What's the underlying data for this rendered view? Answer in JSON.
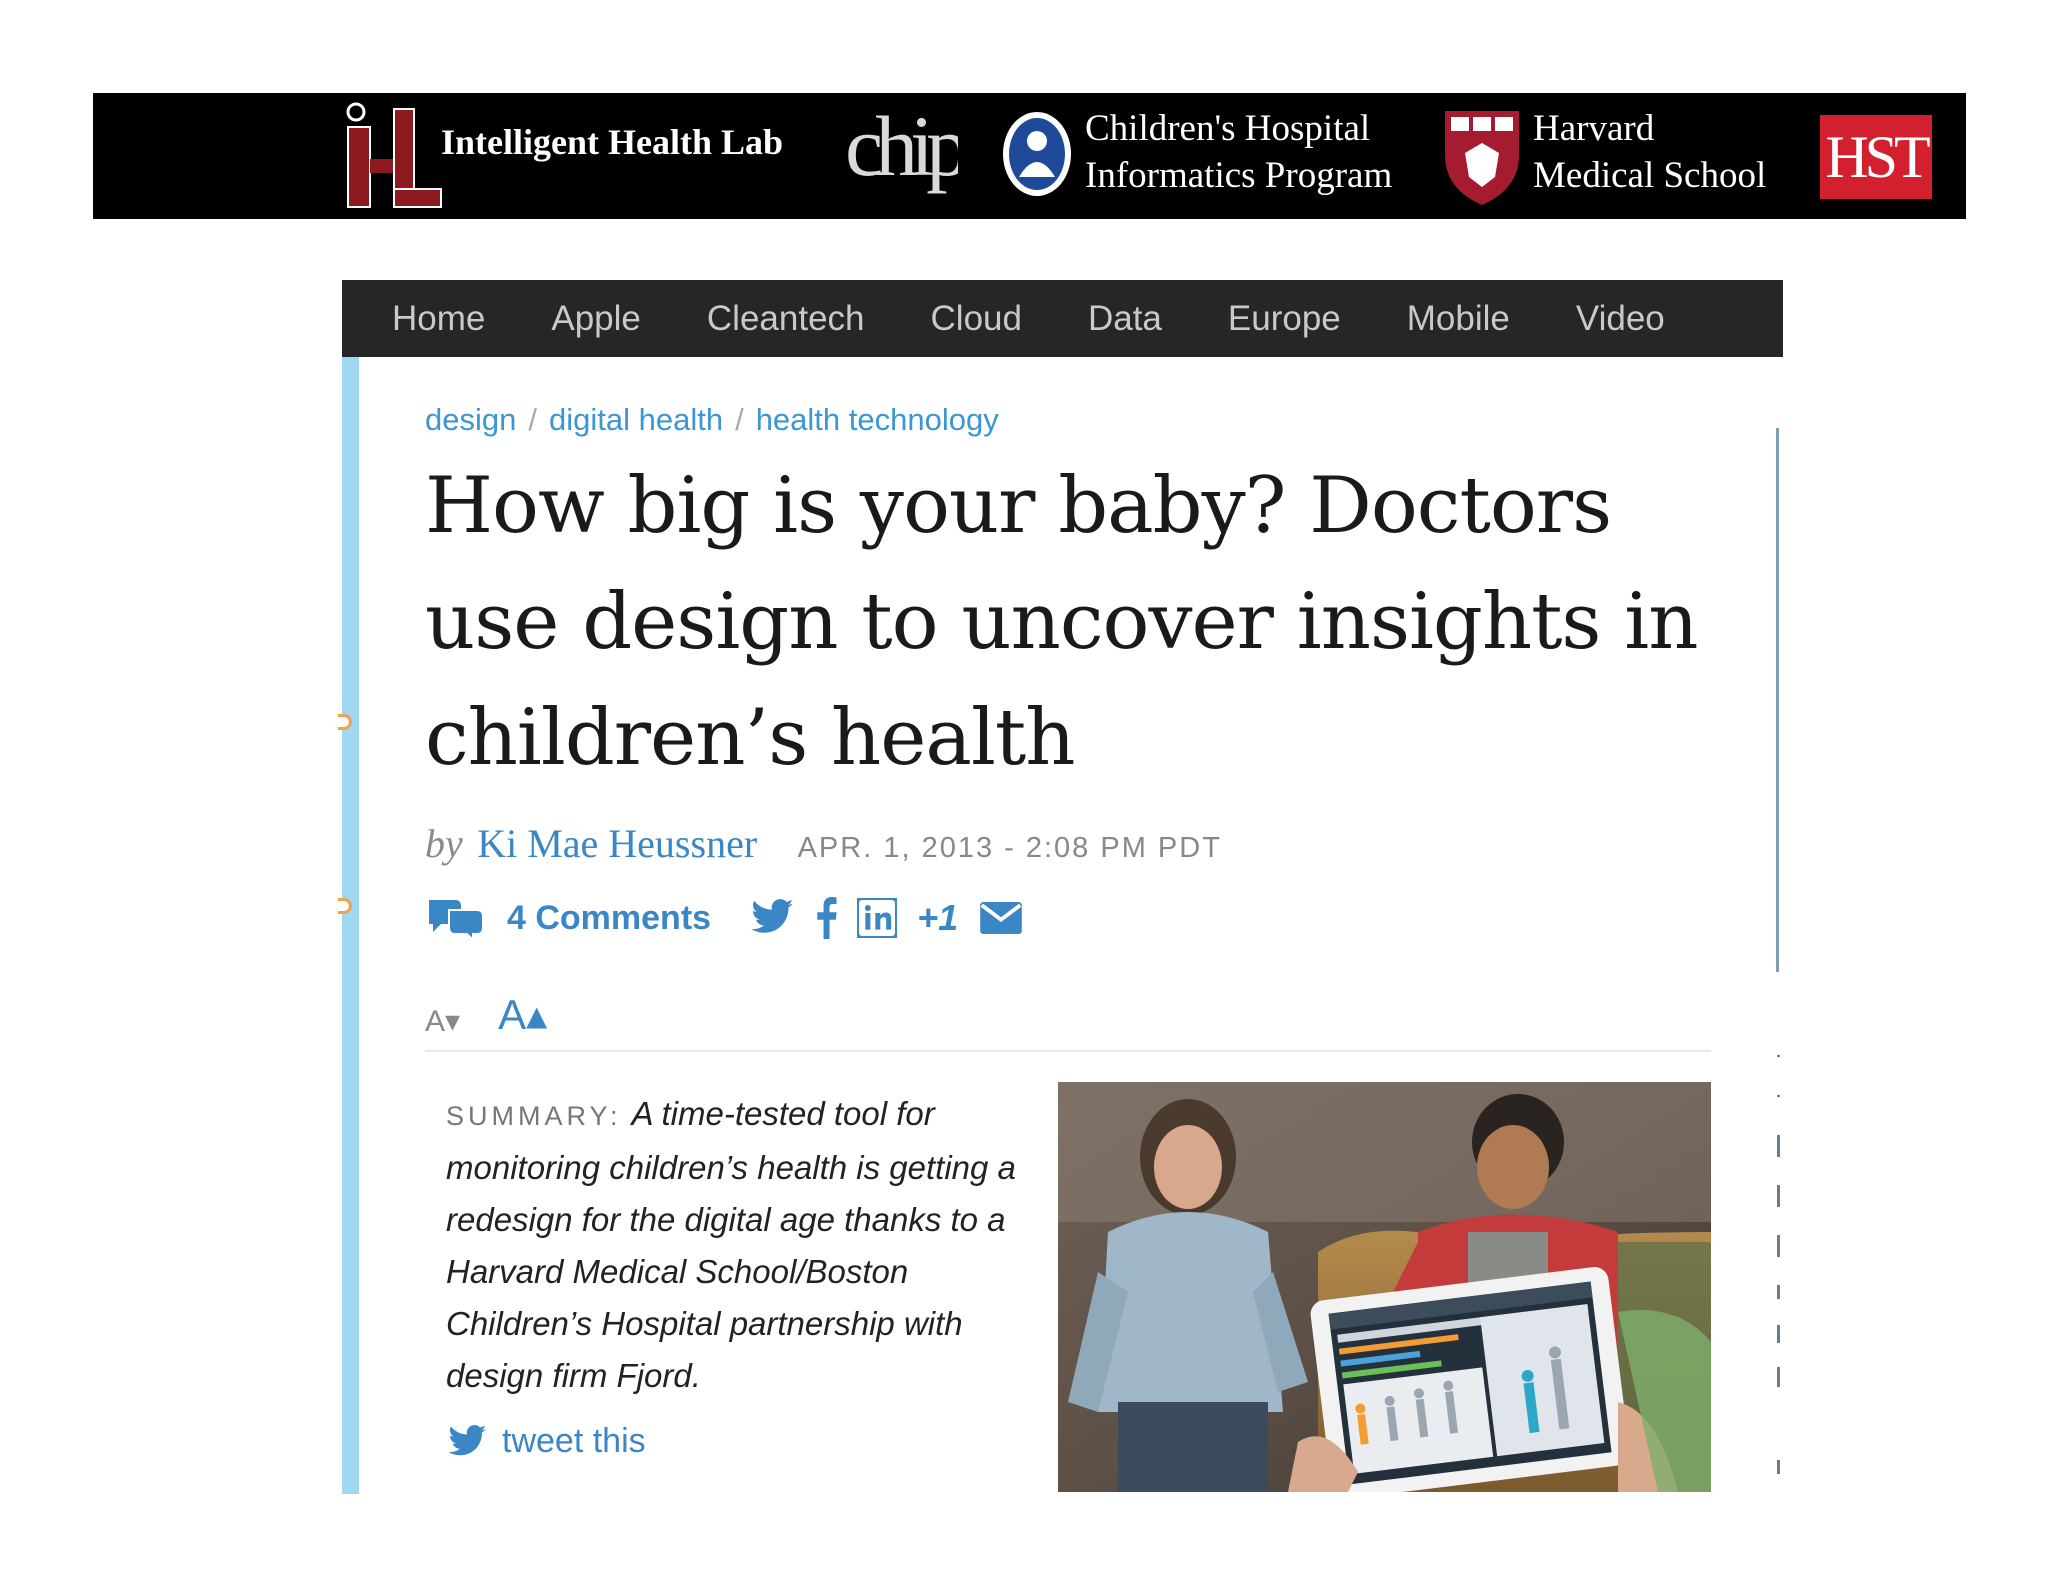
{
  "banner": {
    "ihl_logo_text": "Intelligent Health Lab",
    "chip_logo_text": "chip",
    "chip_name_line1": "Children's Hospital",
    "chip_name_line2": "Informatics Program",
    "hms_line1": "Harvard",
    "hms_line2": "Medical School",
    "hst_logo_text": "HST"
  },
  "nav": {
    "items": [
      "Home",
      "Apple",
      "Cleantech",
      "Cloud",
      "Data",
      "Europe",
      "Mobile",
      "Video"
    ]
  },
  "article": {
    "categories": [
      "design",
      "digital health",
      "health technology"
    ],
    "title": "How big is your baby? Doctors use design to uncover insights in children’s health",
    "byline_prefix": "by",
    "author": "Ki Mae Heussner",
    "date": "APR. 1, 2013 - 2:08 PM PDT",
    "comments_label": "4 Comments",
    "plus_one": "+1",
    "font_smaller": "A▾",
    "font_larger": "A▴",
    "summary_label": "SUMMARY:",
    "summary_text": "A time-tested tool for monitoring children’s health is getting a redesign for the digital age thanks to a Harvard Medical School/Boston Children’s Hospital partnership with design firm Fjord.",
    "tweet_label": "tweet this"
  },
  "colors": {
    "link_blue": "#3b86c4",
    "accent_bar": "#9fd8f2",
    "nav_bg": "#262626",
    "hst_red": "#d3202f"
  },
  "icons": [
    "comment-bubbles-icon",
    "twitter-icon",
    "facebook-icon",
    "linkedin-icon",
    "email-icon",
    "tweet-bird-icon"
  ]
}
